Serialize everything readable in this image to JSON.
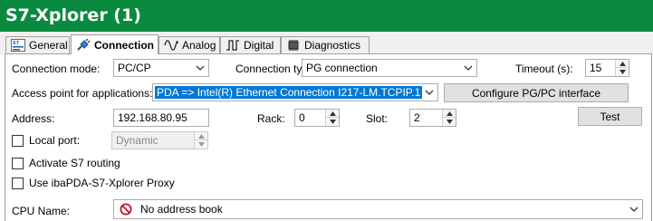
{
  "window": {
    "title": "S7-Xplorer (1)"
  },
  "tabs": [
    {
      "label": "General",
      "icon": "s7-general-icon"
    },
    {
      "label": "Connection",
      "icon": "plug-icon",
      "active": true
    },
    {
      "label": "Analog",
      "icon": "sine-wave-icon"
    },
    {
      "label": "Digital",
      "icon": "square-wave-icon"
    },
    {
      "label": "Diagnostics",
      "icon": "chip-icon"
    }
  ],
  "connection": {
    "mode_label": "Connection mode:",
    "mode_value": "PC/CP",
    "type_label": "Connection type:",
    "type_value": "PG connection",
    "timeout_label": "Timeout (s):",
    "timeout_value": "15",
    "access_label": "Access point for applications:",
    "access_value": "PDA => Intel(R) Ethernet Connection I217-LM.TCPIP.1",
    "configure_button": "Configure PG/PC interface",
    "address_label": "Address:",
    "address_value": "192.168.80.95",
    "rack_label": "Rack:",
    "rack_value": "0",
    "slot_label": "Slot:",
    "slot_value": "2",
    "test_button": "Test",
    "local_port_label": "Local port:",
    "local_port_value": "Dynamic",
    "s7_routing_label": "Activate S7 routing",
    "proxy_label": "Use ibaPDA-S7-Xplorer Proxy",
    "cpu_label": "CPU Name:",
    "cpu_value": "No address book"
  },
  "colors": {
    "titlebar": "#0a8a3e",
    "selection": "#0078d7",
    "no_entry_icon": "#c8102e"
  }
}
